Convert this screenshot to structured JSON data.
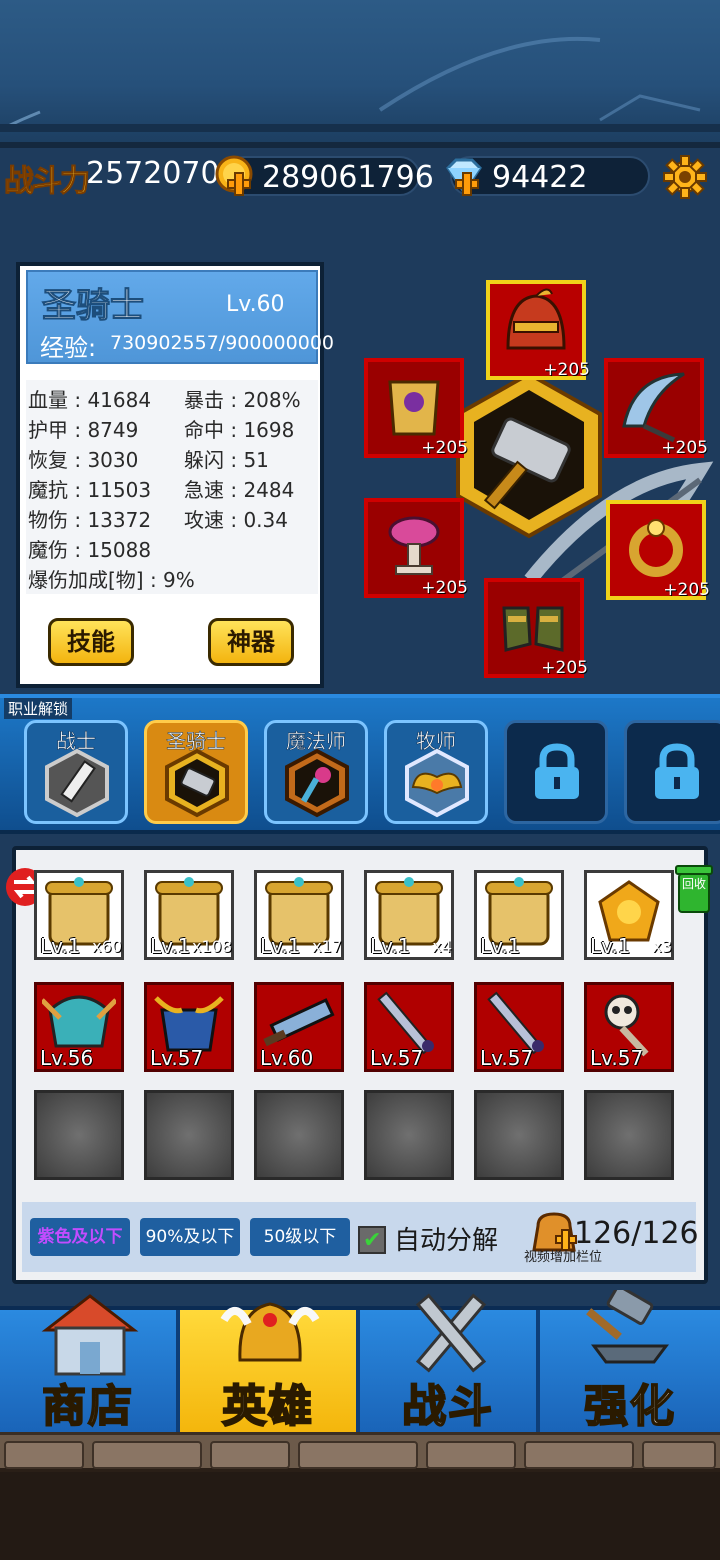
{
  "resources": {
    "power_label": "战斗力",
    "power_value": "2572070",
    "gold": "289061796",
    "gems": "94422",
    "gold_icon": "gold-coin-plus-icon",
    "gem_icon": "diamond-plus-icon",
    "settings_icon": "gear-icon"
  },
  "hero": {
    "name": "圣骑士",
    "level": "Lv.60",
    "exp_label": "经验:",
    "exp_value": "730902557/900000000",
    "stats": [
      "血量 : 41684",
      "暴击 : 208%",
      "护甲 : 8749",
      "命中 : 1698",
      "恢复 : 3030",
      "躲闪 : 51",
      "魔抗 : 11503",
      "急速 : 2484",
      "物伤 : 13372",
      "攻速 : 0.34",
      "魔伤 : 15088",
      "爆伤加成[物] : 9%"
    ],
    "skills_label": "技能",
    "artifact_label": "神器"
  },
  "equipment": {
    "helmet_bonus": "+205",
    "armor_bonus": "+205",
    "weapon_bonus": "+205",
    "trinket_bonus": "+205",
    "ring_bonus": "+205",
    "boots_bonus": "+205",
    "center_weapon_icon": "warhammer-icon"
  },
  "classes": {
    "unlock_label": "职业解锁",
    "items": [
      {
        "label": "战士",
        "icon": "sword-emblem-icon"
      },
      {
        "label": "圣骑士",
        "icon": "hammer-emblem-icon"
      },
      {
        "label": "魔法师",
        "icon": "staff-emblem-icon"
      },
      {
        "label": "牧师",
        "icon": "wings-emblem-icon"
      }
    ]
  },
  "inventory": {
    "scrolls": [
      {
        "level": "Lv.1",
        "qty": "x60"
      },
      {
        "level": "Lv.1",
        "qty": "x108"
      },
      {
        "level": "Lv.1",
        "qty": "x17"
      },
      {
        "level": "Lv.1",
        "qty": "x4"
      },
      {
        "level": "Lv.1",
        "qty": ""
      },
      {
        "level": "Lv.1",
        "qty": "x3"
      }
    ],
    "gear": [
      {
        "level": "Lv.56",
        "icon": "winged-helmet-icon"
      },
      {
        "level": "Lv.57",
        "icon": "horned-armor-icon"
      },
      {
        "level": "Lv.60",
        "icon": "broad-sword-icon"
      },
      {
        "level": "Lv.57",
        "icon": "long-sword-icon"
      },
      {
        "level": "Lv.57",
        "icon": "long-sword-icon"
      },
      {
        "level": "Lv.57",
        "icon": "skull-trinket-icon"
      }
    ],
    "recycle_label": "回收"
  },
  "filters": {
    "purple": "紫色及以下",
    "ninety": "90%及以下",
    "fifty": "50级以下",
    "auto_decompose": "自动分解",
    "auto_checked": true,
    "capacity": "126/126",
    "video_hint": "视频增加栏位"
  },
  "nav": {
    "shop": "商店",
    "hero": "英雄",
    "battle": "战斗",
    "enhance": "强化",
    "active": "hero"
  },
  "colors": {
    "accent_gold": "#ffcf2a",
    "nav_blue": "#2b8ae0",
    "nav_active": "#ffd93a",
    "item_red": "#b00000"
  }
}
